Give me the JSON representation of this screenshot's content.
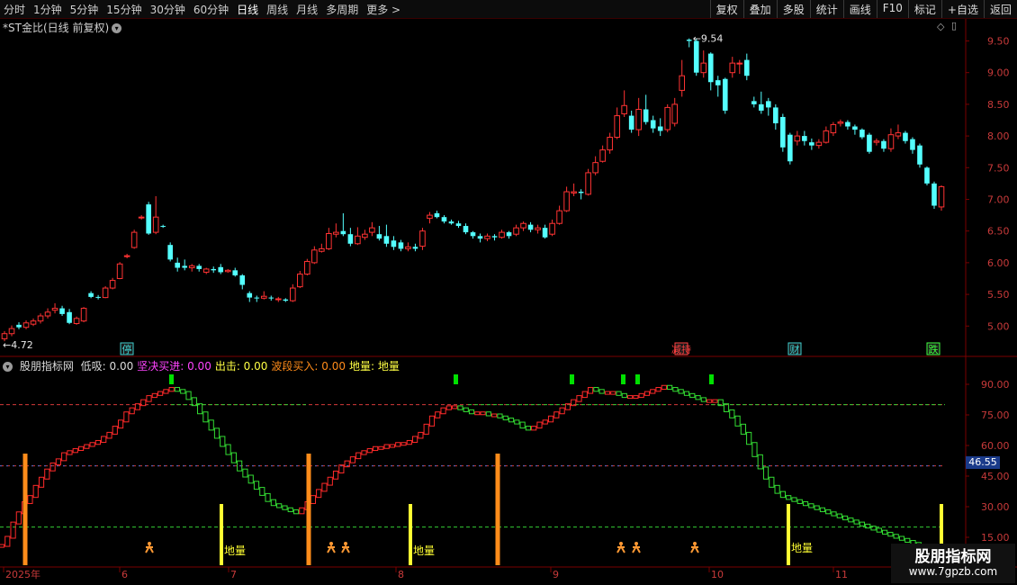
{
  "toolbar": {
    "periods": [
      "分时",
      "1分钟",
      "5分钟",
      "15分钟",
      "30分钟",
      "60分钟",
      "日线",
      "周线",
      "月线",
      "多周期",
      "更多 >"
    ],
    "active_period": "日线",
    "right_buttons": [
      "复权",
      "叠加",
      "多股",
      "统计",
      "画线",
      "F10",
      "标记",
      "+自选",
      "返回"
    ]
  },
  "main_chart": {
    "title": "*ST金比(日线 前复权)",
    "high_label": "9.54",
    "low_label": "4.72",
    "y_ticks": [
      "9.50",
      "9.00",
      "8.50",
      "8.00",
      "7.50",
      "7.00",
      "6.50",
      "6.00",
      "5.50",
      "5.00"
    ],
    "event_tags": [
      "停",
      "减持",
      "财",
      "跌"
    ]
  },
  "indicator": {
    "name": "股朋指标网",
    "fields": [
      {
        "label": "低吸: 0.00",
        "color": "#dcdcdc"
      },
      {
        "label": "坚决买进: 0.00",
        "color": "#ff44ff"
      },
      {
        "label": "出击: 0.00",
        "color": "#ffff44"
      },
      {
        "label": "波段买入: 0.00",
        "color": "#ff8c1a"
      },
      {
        "label": "地量: 地量",
        "color": "#ffff44"
      }
    ],
    "y_ticks": [
      "90.00",
      "75.00",
      "60.00",
      "45.00",
      "30.00",
      "15.00"
    ],
    "current_value": "46.55",
    "diliang_label": "地量"
  },
  "time_axis": {
    "labels": [
      "2025年",
      "6",
      "7",
      "8",
      "9",
      "10",
      "11"
    ]
  },
  "watermark": {
    "title": "股朋指标网",
    "url": "www.7gpzb.com"
  },
  "colors": {
    "up": "#ff3333",
    "down": "#54ffff",
    "osc_up": "#ff2a2a",
    "osc_down": "#33dd33",
    "yellow": "#ffff33",
    "orange": "#ff8c1a",
    "green_signal": "#00e000"
  },
  "chart_data": {
    "type": "candlestick",
    "ylim": [
      4.72,
      9.72
    ],
    "candles": [
      {
        "o": 4.8,
        "c": 4.88,
        "h": 4.92,
        "l": 4.76
      },
      {
        "o": 4.88,
        "c": 4.96,
        "h": 5.01,
        "l": 4.84
      },
      {
        "o": 5.02,
        "c": 4.98,
        "h": 5.06,
        "l": 4.95
      },
      {
        "o": 4.98,
        "c": 5.05,
        "h": 5.09,
        "l": 4.95
      },
      {
        "o": 5.03,
        "c": 5.08,
        "h": 5.12,
        "l": 5.0
      },
      {
        "o": 5.08,
        "c": 5.16,
        "h": 5.2,
        "l": 5.04
      },
      {
        "o": 5.16,
        "c": 5.22,
        "h": 5.28,
        "l": 5.12
      },
      {
        "o": 5.25,
        "c": 5.28,
        "h": 5.36,
        "l": 5.2
      },
      {
        "o": 5.28,
        "c": 5.19,
        "h": 5.32,
        "l": 5.16
      },
      {
        "o": 5.22,
        "c": 5.05,
        "h": 5.27,
        "l": 5.03
      },
      {
        "o": 5.04,
        "c": 5.12,
        "h": 5.15,
        "l": 5.02
      },
      {
        "o": 5.08,
        "c": 5.28,
        "h": 5.3,
        "l": 5.06
      },
      {
        "o": 5.52,
        "c": 5.46,
        "h": 5.55,
        "l": 5.44
      },
      {
        "o": 5.46,
        "c": 5.45,
        "h": 5.49,
        "l": 5.42
      },
      {
        "o": 5.45,
        "c": 5.6,
        "h": 5.63,
        "l": 5.44
      },
      {
        "o": 5.6,
        "c": 5.72,
        "h": 5.76,
        "l": 5.58
      },
      {
        "o": 5.75,
        "c": 5.98,
        "h": 6.01,
        "l": 5.74
      },
      {
        "o": 6.1,
        "c": 6.11,
        "h": 6.14,
        "l": 6.07
      },
      {
        "o": 6.24,
        "c": 6.48,
        "h": 6.52,
        "l": 6.22
      },
      {
        "o": 6.72,
        "c": 6.72,
        "h": 6.75,
        "l": 6.68
      },
      {
        "o": 6.92,
        "c": 6.46,
        "h": 6.96,
        "l": 6.44
      },
      {
        "o": 6.48,
        "c": 6.72,
        "h": 7.05,
        "l": 6.45
      },
      {
        "o": 6.58,
        "c": 6.57,
        "h": 6.6,
        "l": 6.55
      },
      {
        "o": 6.28,
        "c": 6.05,
        "h": 6.32,
        "l": 6.02
      },
      {
        "o": 6.0,
        "c": 5.92,
        "h": 6.08,
        "l": 5.86
      },
      {
        "o": 5.95,
        "c": 5.92,
        "h": 6.05,
        "l": 5.88
      },
      {
        "o": 5.92,
        "c": 5.95,
        "h": 5.98,
        "l": 5.86
      },
      {
        "o": 5.95,
        "c": 5.9,
        "h": 5.98,
        "l": 5.86
      },
      {
        "o": 5.85,
        "c": 5.9,
        "h": 5.92,
        "l": 5.82
      },
      {
        "o": 5.9,
        "c": 5.88,
        "h": 5.94,
        "l": 5.84
      },
      {
        "o": 5.93,
        "c": 5.85,
        "h": 5.98,
        "l": 5.82
      },
      {
        "o": 5.86,
        "c": 5.88,
        "h": 5.9,
        "l": 5.84
      },
      {
        "o": 5.88,
        "c": 5.8,
        "h": 5.92,
        "l": 5.78
      },
      {
        "o": 5.8,
        "c": 5.65,
        "h": 5.82,
        "l": 5.58
      },
      {
        "o": 5.52,
        "c": 5.45,
        "h": 5.55,
        "l": 5.38
      },
      {
        "o": 5.45,
        "c": 5.44,
        "h": 5.48,
        "l": 5.38
      },
      {
        "o": 5.44,
        "c": 5.47,
        "h": 5.55,
        "l": 5.42
      },
      {
        "o": 5.45,
        "c": 5.44,
        "h": 5.48,
        "l": 5.4
      },
      {
        "o": 5.42,
        "c": 5.43,
        "h": 5.46,
        "l": 5.38
      },
      {
        "o": 5.42,
        "c": 5.4,
        "h": 5.44,
        "l": 5.38
      },
      {
        "o": 5.4,
        "c": 5.6,
        "h": 5.66,
        "l": 5.38
      },
      {
        "o": 5.62,
        "c": 5.82,
        "h": 5.87,
        "l": 5.6
      },
      {
        "o": 5.82,
        "c": 6.02,
        "h": 6.06,
        "l": 5.8
      },
      {
        "o": 6.0,
        "c": 6.2,
        "h": 6.26,
        "l": 5.98
      },
      {
        "o": 6.18,
        "c": 6.22,
        "h": 6.3,
        "l": 6.16
      },
      {
        "o": 6.22,
        "c": 6.46,
        "h": 6.55,
        "l": 6.2
      },
      {
        "o": 6.45,
        "c": 6.48,
        "h": 6.62,
        "l": 6.4
      },
      {
        "o": 6.5,
        "c": 6.45,
        "h": 6.78,
        "l": 6.42
      },
      {
        "o": 6.45,
        "c": 6.3,
        "h": 6.55,
        "l": 6.26
      },
      {
        "o": 6.3,
        "c": 6.42,
        "h": 6.56,
        "l": 6.28
      },
      {
        "o": 6.4,
        "c": 6.45,
        "h": 6.52,
        "l": 6.36
      },
      {
        "o": 6.48,
        "c": 6.55,
        "h": 6.64,
        "l": 6.42
      },
      {
        "o": 6.45,
        "c": 6.38,
        "h": 6.58,
        "l": 6.35
      },
      {
        "o": 6.42,
        "c": 6.3,
        "h": 6.6,
        "l": 6.25
      },
      {
        "o": 6.35,
        "c": 6.25,
        "h": 6.42,
        "l": 6.2
      },
      {
        "o": 6.32,
        "c": 6.22,
        "h": 6.36,
        "l": 6.18
      },
      {
        "o": 6.22,
        "c": 6.25,
        "h": 6.32,
        "l": 6.18
      },
      {
        "o": 6.25,
        "c": 6.22,
        "h": 6.3,
        "l": 6.18
      },
      {
        "o": 6.26,
        "c": 6.5,
        "h": 6.55,
        "l": 6.2
      },
      {
        "o": 6.7,
        "c": 6.75,
        "h": 6.8,
        "l": 6.62
      },
      {
        "o": 6.78,
        "c": 6.72,
        "h": 6.82,
        "l": 6.7
      },
      {
        "o": 6.72,
        "c": 6.65,
        "h": 6.75,
        "l": 6.62
      },
      {
        "o": 6.65,
        "c": 6.62,
        "h": 6.68,
        "l": 6.6
      },
      {
        "o": 6.62,
        "c": 6.58,
        "h": 6.66,
        "l": 6.55
      },
      {
        "o": 6.58,
        "c": 6.48,
        "h": 6.62,
        "l": 6.45
      },
      {
        "o": 6.48,
        "c": 6.42,
        "h": 6.5,
        "l": 6.38
      },
      {
        "o": 6.42,
        "c": 6.38,
        "h": 6.46,
        "l": 6.32
      },
      {
        "o": 6.38,
        "c": 6.42,
        "h": 6.46,
        "l": 6.34
      },
      {
        "o": 6.42,
        "c": 6.4,
        "h": 6.45,
        "l": 6.35
      },
      {
        "o": 6.4,
        "c": 6.48,
        "h": 6.52,
        "l": 6.38
      },
      {
        "o": 6.48,
        "c": 6.42,
        "h": 6.5,
        "l": 6.38
      },
      {
        "o": 6.45,
        "c": 6.55,
        "h": 6.6,
        "l": 6.42
      },
      {
        "o": 6.55,
        "c": 6.62,
        "h": 6.65,
        "l": 6.5
      },
      {
        "o": 6.6,
        "c": 6.52,
        "h": 6.64,
        "l": 6.48
      },
      {
        "o": 6.52,
        "c": 6.55,
        "h": 6.6,
        "l": 6.46
      },
      {
        "o": 6.55,
        "c": 6.4,
        "h": 6.6,
        "l": 6.38
      },
      {
        "o": 6.45,
        "c": 6.62,
        "h": 6.68,
        "l": 6.42
      },
      {
        "o": 6.62,
        "c": 6.82,
        "h": 6.9,
        "l": 6.6
      },
      {
        "o": 6.82,
        "c": 7.12,
        "h": 7.2,
        "l": 6.8
      },
      {
        "o": 7.1,
        "c": 7.12,
        "h": 7.25,
        "l": 7.05
      },
      {
        "o": 7.12,
        "c": 7.1,
        "h": 7.16,
        "l": 7.0
      },
      {
        "o": 7.08,
        "c": 7.42,
        "h": 7.48,
        "l": 7.06
      },
      {
        "o": 7.42,
        "c": 7.58,
        "h": 7.68,
        "l": 7.38
      },
      {
        "o": 7.6,
        "c": 7.78,
        "h": 7.85,
        "l": 7.58
      },
      {
        "o": 7.78,
        "c": 7.98,
        "h": 8.05,
        "l": 7.72
      },
      {
        "o": 7.98,
        "c": 8.32,
        "h": 8.45,
        "l": 7.95
      },
      {
        "o": 8.35,
        "c": 8.48,
        "h": 8.72,
        "l": 8.3
      },
      {
        "o": 8.32,
        "c": 8.1,
        "h": 8.4,
        "l": 8.05
      },
      {
        "o": 8.1,
        "c": 8.42,
        "h": 8.6,
        "l": 8.0
      },
      {
        "o": 8.42,
        "c": 8.22,
        "h": 8.65,
        "l": 8.18
      },
      {
        "o": 8.25,
        "c": 8.12,
        "h": 8.32,
        "l": 8.05
      },
      {
        "o": 8.15,
        "c": 8.08,
        "h": 8.28,
        "l": 8.0
      },
      {
        "o": 8.1,
        "c": 8.45,
        "h": 8.5,
        "l": 8.06
      },
      {
        "o": 8.2,
        "c": 8.5,
        "h": 8.6,
        "l": 8.15
      },
      {
        "o": 8.72,
        "c": 8.95,
        "h": 9.2,
        "l": 8.62
      },
      {
        "o": 9.52,
        "c": 9.5,
        "h": 9.54,
        "l": 9.4
      },
      {
        "o": 9.5,
        "c": 9.0,
        "h": 9.54,
        "l": 8.95
      },
      {
        "o": 9.0,
        "c": 9.15,
        "h": 9.35,
        "l": 8.92
      },
      {
        "o": 9.3,
        "c": 8.85,
        "h": 9.32,
        "l": 8.72
      },
      {
        "o": 8.88,
        "c": 8.8,
        "h": 8.95,
        "l": 8.62
      },
      {
        "o": 8.9,
        "c": 8.4,
        "h": 8.92,
        "l": 8.35
      },
      {
        "o": 9.0,
        "c": 9.15,
        "h": 9.25,
        "l": 8.92
      },
      {
        "o": 9.15,
        "c": 9.15,
        "h": 9.2,
        "l": 8.98
      },
      {
        "o": 9.2,
        "c": 8.95,
        "h": 9.3,
        "l": 8.88
      },
      {
        "o": 8.55,
        "c": 8.5,
        "h": 8.62,
        "l": 8.45
      },
      {
        "o": 8.5,
        "c": 8.4,
        "h": 8.7,
        "l": 8.35
      },
      {
        "o": 8.55,
        "c": 8.45,
        "h": 8.6,
        "l": 8.32
      },
      {
        "o": 8.45,
        "c": 8.2,
        "h": 8.5,
        "l": 8.1
      },
      {
        "o": 8.3,
        "c": 7.82,
        "h": 8.35,
        "l": 7.75
      },
      {
        "o": 8.02,
        "c": 7.6,
        "h": 8.05,
        "l": 7.55
      },
      {
        "o": 7.92,
        "c": 8.0,
        "h": 8.08,
        "l": 7.85
      },
      {
        "o": 8.0,
        "c": 7.92,
        "h": 8.08,
        "l": 7.85
      },
      {
        "o": 7.9,
        "c": 7.85,
        "h": 7.96,
        "l": 7.78
      },
      {
        "o": 7.85,
        "c": 7.9,
        "h": 7.95,
        "l": 7.8
      },
      {
        "o": 7.9,
        "c": 8.08,
        "h": 8.15,
        "l": 7.88
      },
      {
        "o": 8.05,
        "c": 8.18,
        "h": 8.22,
        "l": 8.0
      },
      {
        "o": 8.2,
        "c": 8.22,
        "h": 8.26,
        "l": 8.15
      },
      {
        "o": 8.22,
        "c": 8.15,
        "h": 8.25,
        "l": 8.1
      },
      {
        "o": 8.15,
        "c": 8.1,
        "h": 8.18,
        "l": 8.02
      },
      {
        "o": 8.1,
        "c": 7.98,
        "h": 8.12,
        "l": 7.95
      },
      {
        "o": 8.02,
        "c": 7.75,
        "h": 8.05,
        "l": 7.72
      },
      {
        "o": 7.9,
        "c": 7.92,
        "h": 7.96,
        "l": 7.85
      },
      {
        "o": 7.92,
        "c": 7.8,
        "h": 7.95,
        "l": 7.75
      },
      {
        "o": 7.8,
        "c": 8.02,
        "h": 8.12,
        "l": 7.75
      },
      {
        "o": 8.0,
        "c": 8.05,
        "h": 8.18,
        "l": 7.95
      },
      {
        "o": 8.05,
        "c": 7.92,
        "h": 8.08,
        "l": 7.88
      },
      {
        "o": 7.95,
        "c": 7.78,
        "h": 7.98,
        "l": 7.72
      },
      {
        "o": 7.85,
        "c": 7.55,
        "h": 7.88,
        "l": 7.5
      },
      {
        "o": 7.5,
        "c": 7.25,
        "h": 7.52,
        "l": 7.22
      },
      {
        "o": 7.25,
        "c": 6.9,
        "h": 7.28,
        "l": 6.85
      },
      {
        "o": 6.88,
        "c": 7.2,
        "h": 7.22,
        "l": 6.82
      }
    ],
    "oscillator": [
      11,
      15,
      22,
      27,
      32,
      35,
      40,
      44,
      48,
      51,
      53,
      56,
      57,
      58,
      59,
      60,
      61,
      62,
      64,
      66,
      69,
      72,
      76,
      78,
      80,
      82,
      84,
      85,
      86,
      87,
      88,
      87,
      86,
      83,
      80,
      76,
      72,
      68,
      64,
      60,
      56,
      52,
      48,
      45,
      42,
      39,
      36,
      33,
      31,
      30,
      29,
      28,
      27,
      29,
      32,
      35,
      38,
      41,
      44,
      47,
      50,
      52,
      54,
      56,
      57,
      58,
      59,
      59,
      60,
      60,
      61,
      61,
      62,
      64,
      66,
      70,
      74,
      76,
      78,
      79,
      79,
      78,
      77,
      76,
      76,
      76,
      75,
      75,
      74,
      73,
      72,
      71,
      69,
      68,
      69,
      71,
      72,
      74,
      76,
      78,
      80,
      82,
      84,
      86,
      88,
      87,
      86,
      86,
      86,
      85,
      84,
      84,
      84,
      85,
      86,
      87,
      88,
      89,
      88,
      87,
      86,
      85,
      84,
      83,
      82,
      82,
      82,
      80,
      77,
      74,
      70,
      66,
      61,
      55,
      49,
      44,
      40,
      37,
      35,
      34,
      33,
      32,
      31,
      30,
      29,
      28,
      27,
      26,
      25,
      24,
      23,
      22,
      21,
      20,
      19,
      18,
      17,
      16,
      15,
      14,
      13,
      12,
      11,
      10,
      9,
      8,
      7
    ]
  }
}
